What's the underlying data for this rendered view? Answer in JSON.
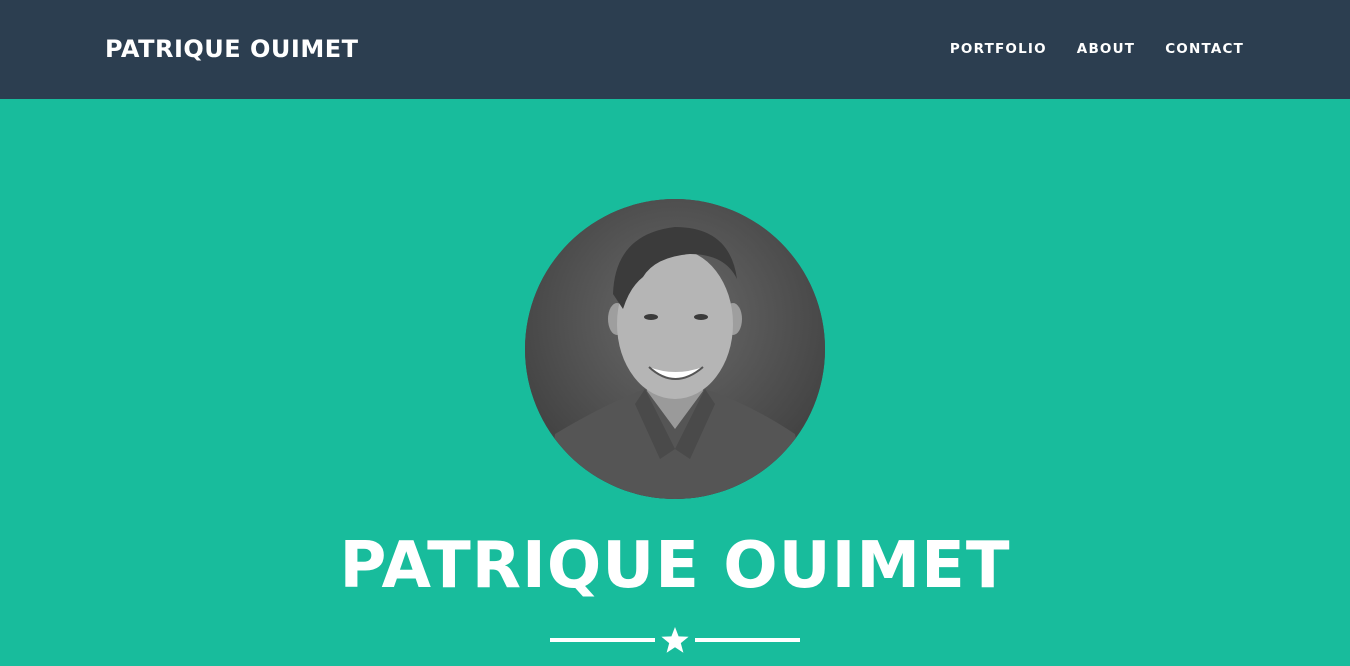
{
  "navbar": {
    "brand": "PATRIQUE OUIMET",
    "links": [
      {
        "label": "PORTFOLIO"
      },
      {
        "label": "ABOUT"
      },
      {
        "label": "CONTACT"
      }
    ]
  },
  "hero": {
    "title": "PATRIQUE OUIMET",
    "divider_icon": "star-icon"
  },
  "colors": {
    "navbar_bg": "#2c3e50",
    "hero_bg": "#18bc9c",
    "text": "#ffffff"
  }
}
